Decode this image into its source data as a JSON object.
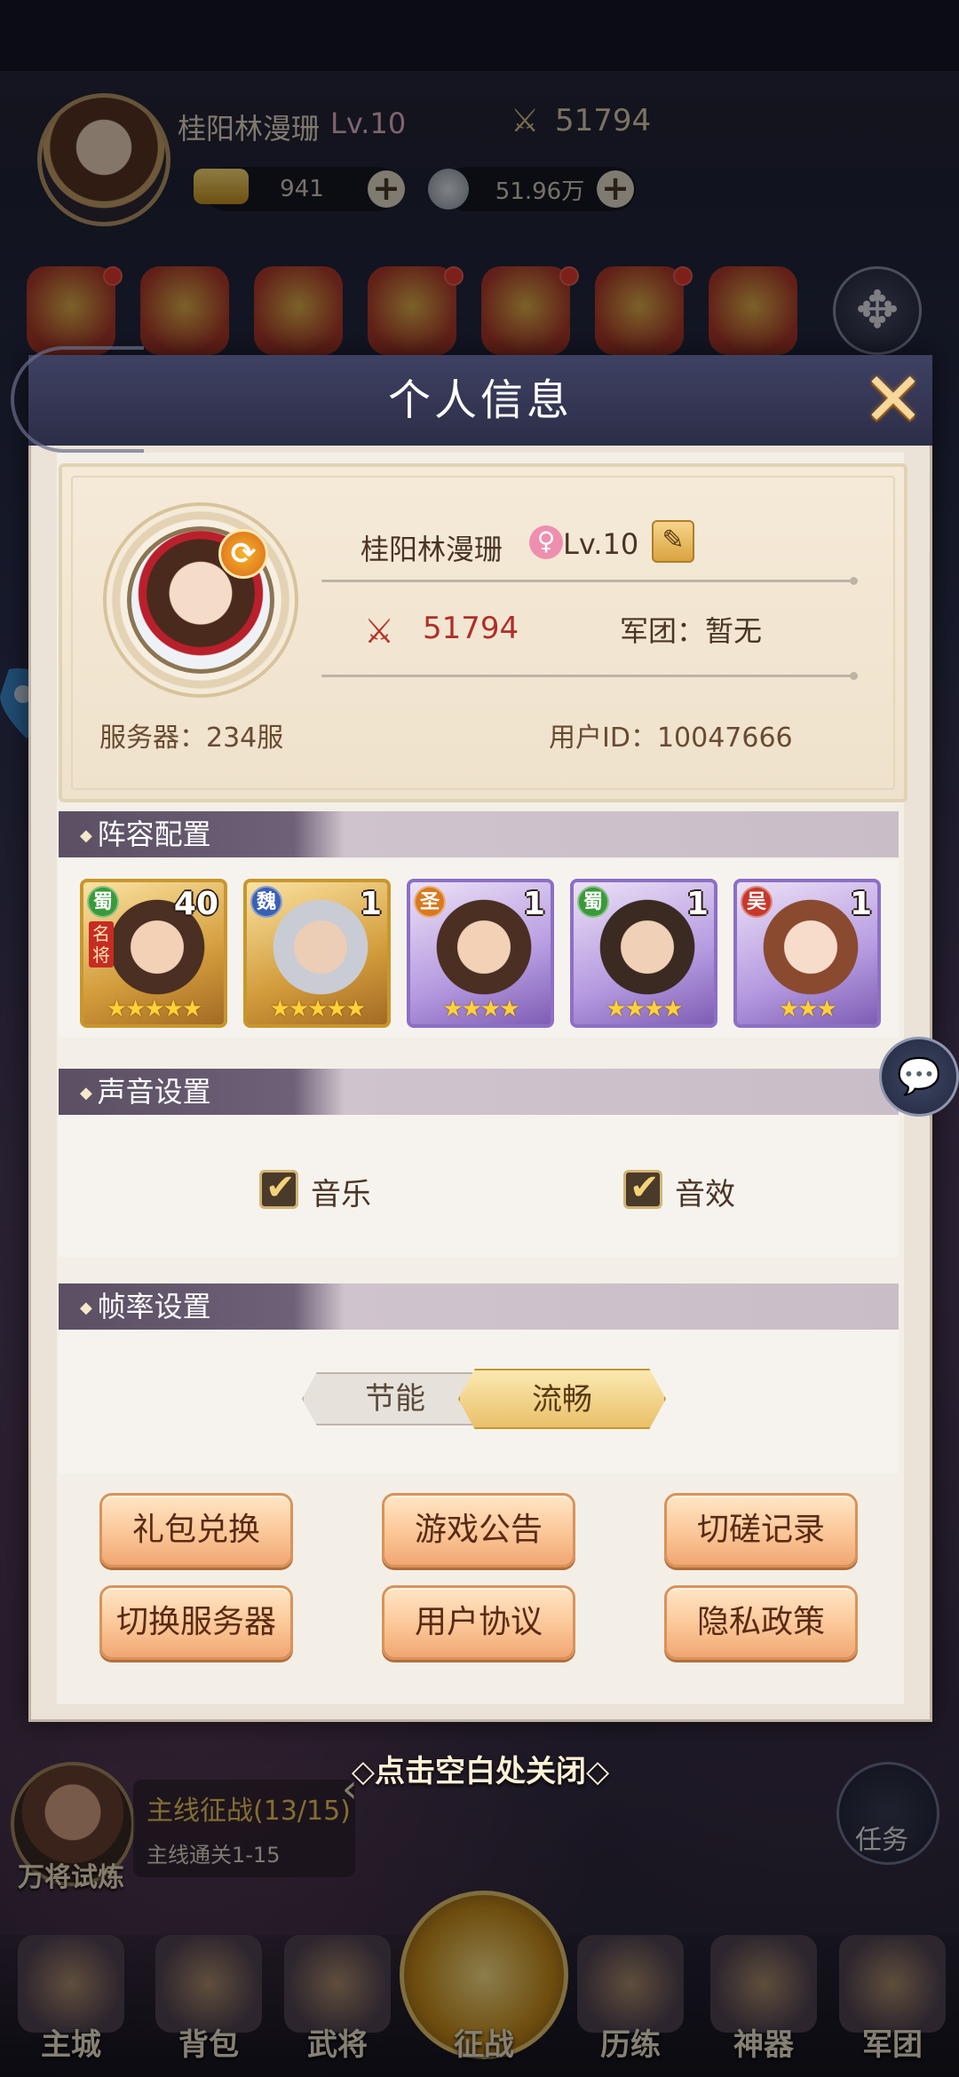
{
  "hud": {
    "player_name": "桂阳林漫珊",
    "player_level": "Lv.10",
    "power": "51794",
    "gold": "941",
    "silver": "51.96万"
  },
  "quest": {
    "avatar_label": "万将试炼",
    "title": "主线征战(13/15)",
    "subtitle": "主线通关1-15",
    "task_label": "任务"
  },
  "nav": [
    "主城",
    "背包",
    "武将",
    "征战",
    "历练",
    "神器",
    "军团"
  ],
  "modal": {
    "title": "个人信息",
    "profile": {
      "name": "桂阳林漫珊",
      "gender_symbol": "♀",
      "level": "Lv.10",
      "power": "51794",
      "legion": "军团：暂无",
      "server": "服务器：234服",
      "user_id": "用户ID：10047666"
    },
    "team_header": "阵容配置",
    "heroes": [
      {
        "faction": "蜀",
        "level": "40",
        "stars": "★★★★★",
        "tag": "名将",
        "rarity": "gold",
        "faction_color": "#3a9a3a"
      },
      {
        "faction": "魏",
        "level": "1",
        "stars": "★★★★★",
        "rarity": "gold",
        "faction_color": "#3a5fb4"
      },
      {
        "faction": "圣",
        "level": "1",
        "stars": "★★★★",
        "rarity": "purple",
        "faction_color": "#d9791f"
      },
      {
        "faction": "蜀",
        "level": "1",
        "stars": "★★★★",
        "rarity": "purple",
        "faction_color": "#3a9a3a"
      },
      {
        "faction": "吴",
        "level": "1",
        "stars": "★★★",
        "rarity": "purple",
        "faction_color": "#c8372b"
      }
    ],
    "sound_header": "声音设置",
    "music_label": "音乐",
    "sfx_label": "音效",
    "frame_header": "帧率设置",
    "frame_options": [
      "节能",
      "流畅"
    ],
    "frame_selected": "流畅",
    "buttons": [
      "礼包兑换",
      "游戏公告",
      "切磋记录",
      "切换服务器",
      "用户协议",
      "隐私政策"
    ],
    "tap_to_close": "◇点击空白处关闭◇"
  }
}
